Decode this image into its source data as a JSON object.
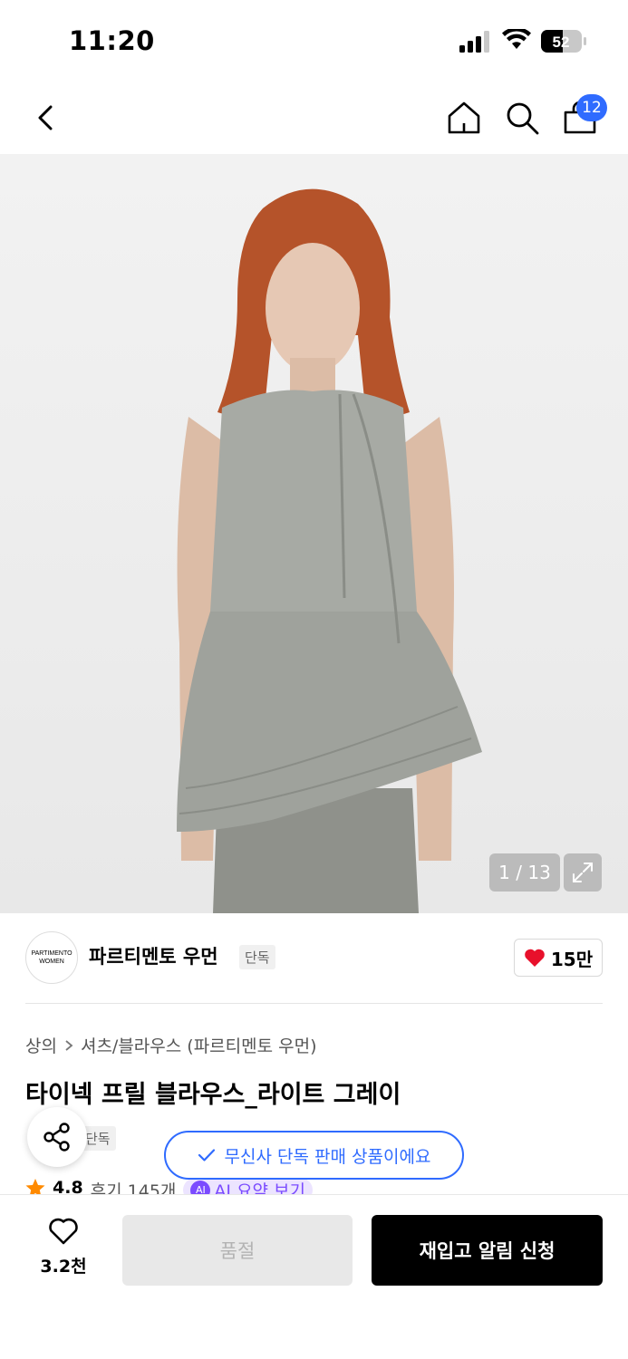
{
  "status_bar": {
    "time": "11:20",
    "battery": "52"
  },
  "nav": {
    "cart_count": "12"
  },
  "hero": {
    "counter": "1 / 13"
  },
  "brand": {
    "logo_text_1": "PARTIMENTO",
    "logo_text_2": "WOMEN",
    "name": "파르티멘토 우먼",
    "tag": "단독",
    "like_count": "15만"
  },
  "breadcrumb": [
    "상의",
    "셔츠/블라우스 (파르티멘토 우먼)"
  ],
  "product": {
    "title": "타이넥 프릴 블라우스_라이트 그레이",
    "tag": "단독",
    "rating": "4.8",
    "reviews": "후기 145개",
    "ai_label": "AI",
    "ai_summary": "AI 요약 보기"
  },
  "toast": {
    "message": "무신사 단독 판매 상품이에요"
  },
  "bottom_bar": {
    "wish_count": "3.2천",
    "sold_out_label": "품절",
    "restock_label": "재입고 알림 신청"
  },
  "colors": {
    "accent": "#2f6bff",
    "heart": "#e8102b",
    "ai": "#7b4bff"
  },
  "icons": [
    "back-arrow-icon",
    "home-icon",
    "search-icon",
    "cart-icon",
    "expand-icon",
    "heart-icon",
    "share-icon",
    "check-icon",
    "star-icon",
    "heart-outline-icon"
  ]
}
